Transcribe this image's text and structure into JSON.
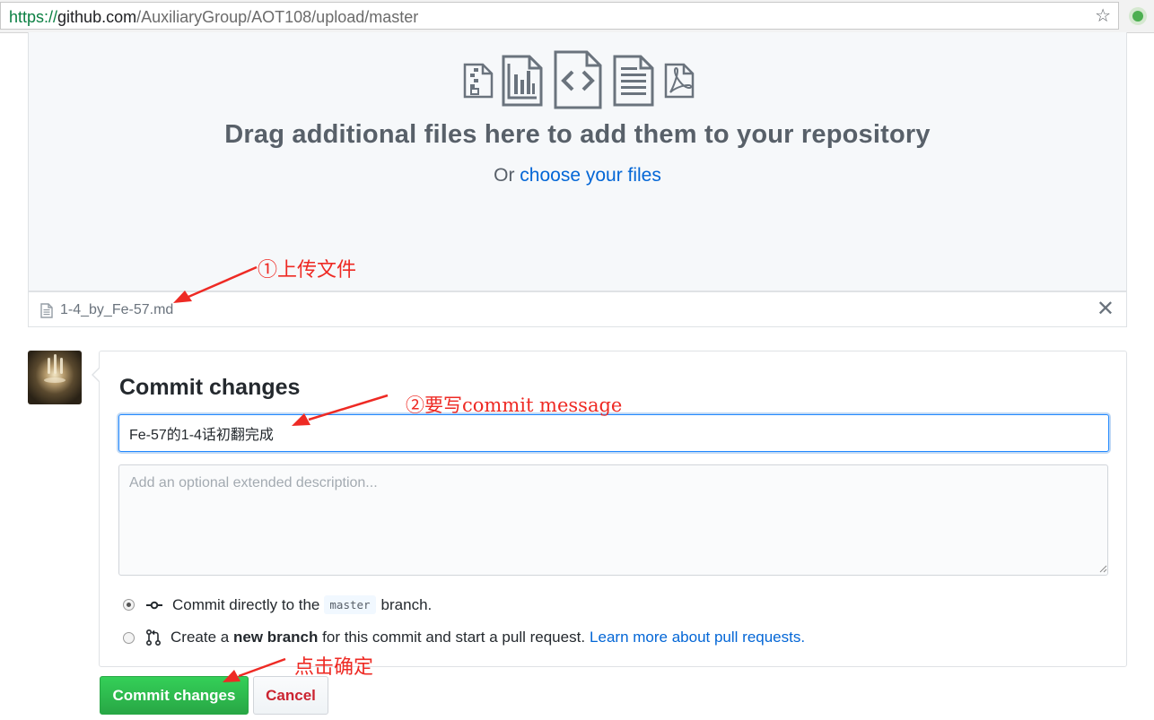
{
  "browser": {
    "url_scheme": "https://",
    "url_host": "github.com",
    "url_path": "/AuxiliaryGroup/AOT108/upload/master",
    "bookmark_icon": "star-icon",
    "extension_icon": "green-dot-icon"
  },
  "dropzone": {
    "icons": [
      "zip-file-icon",
      "chart-file-icon",
      "code-file-icon",
      "text-file-icon",
      "pdf-file-icon"
    ],
    "title": "Drag additional files here to add them to your repository",
    "or_text": "Or",
    "choose_link": "choose your files"
  },
  "uploaded_file": {
    "name": "1-4_by_Fe-57.md",
    "remove_icon": "close-icon"
  },
  "commit": {
    "heading": "Commit changes",
    "summary_value": "Fe-57的1-4话初翻完成",
    "description_placeholder": "Add an optional extended description...",
    "option_direct": {
      "before": "Commit directly to the",
      "branch": "master",
      "after": "branch."
    },
    "option_new_branch": {
      "before": "Create a",
      "bold": "new branch",
      "after": "for this commit and start a pull request.",
      "link": "Learn more about pull requests."
    },
    "submit_label": "Commit changes",
    "cancel_label": "Cancel"
  },
  "annotations": {
    "step1": "①上传文件",
    "step2": "②要写commit message",
    "step3": "点击确定"
  },
  "colors": {
    "annotation": "#ee2a24",
    "link": "#0366d6",
    "commit_button": "#28a745",
    "cancel_text": "#cb2431"
  }
}
